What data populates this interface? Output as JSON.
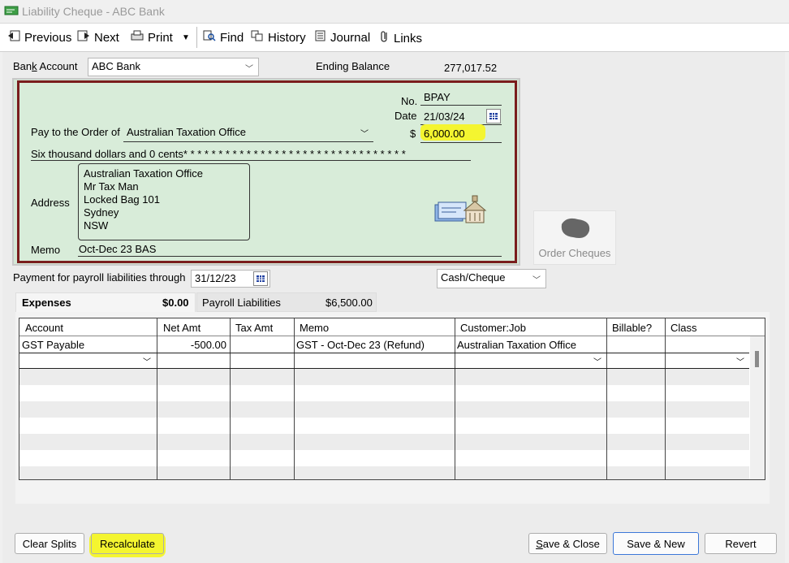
{
  "window": {
    "title": "Liability Cheque - ABC Bank"
  },
  "toolbar": {
    "previous": "Previous",
    "next": "Next",
    "print": "Print",
    "find": "Find",
    "history": "History",
    "journal": "Journal",
    "links": "Links"
  },
  "bank": {
    "label_pre": "Ban",
    "label_u": "k",
    "label_post": " Account",
    "account": "ABC Bank",
    "ending_balance_label": "Ending Balance",
    "ending_balance": "277,017.52"
  },
  "cheque": {
    "no_label": "No.",
    "no": "BPAY",
    "date_label": "Date",
    "date": "21/03/24",
    "payto_label": "Pay to the Order of",
    "payee": "Australian Taxation Office",
    "dollar_sign": "$",
    "amount": "6,000.00",
    "amount_words": "Six thousand  dollars and 0 cents* * * * * * * * * * * * * * * * * * * * * * * * * * * * * * * *",
    "address_label": "Address",
    "address_lines": [
      "Australian Taxation Office",
      "Mr Tax Man",
      "Locked Bag 101",
      "Sydney",
      "NSW"
    ],
    "memo_label": "Memo",
    "memo": "Oct-Dec 23 BAS"
  },
  "order_cheques": "Order Cheques",
  "payroll": {
    "through_label": "Payment for payroll liabilities through",
    "through_date": "31/12/23",
    "method": "Cash/Cheque"
  },
  "tabs": {
    "expenses_label": "Expenses",
    "expenses_amount": "$0.00",
    "payroll_label": "Payroll Liabilities",
    "payroll_amount": "$6,500.00"
  },
  "table": {
    "headers": [
      "Account",
      "Net Amt",
      "Tax Amt",
      "Memo",
      "Customer:Job",
      "Billable?",
      "Class"
    ],
    "rows": [
      {
        "account": "GST Payable",
        "net": "-500.00",
        "tax": "",
        "memo": "GST - Oct-Dec 23 (Refund)",
        "customer": "Australian Taxation Office",
        "billable": "",
        "class": ""
      }
    ]
  },
  "buttons": {
    "clear_splits": "Clear Splits",
    "recalculate": "Recalculate",
    "save_close_u": "S",
    "save_close_rest": "ave & Close",
    "save_new": "Save & New",
    "revert": "Revert"
  },
  "colors": {
    "cheque_bg": "#d8ecd9",
    "cheque_border": "#7a1d1d",
    "highlight": "#f7f72a"
  }
}
